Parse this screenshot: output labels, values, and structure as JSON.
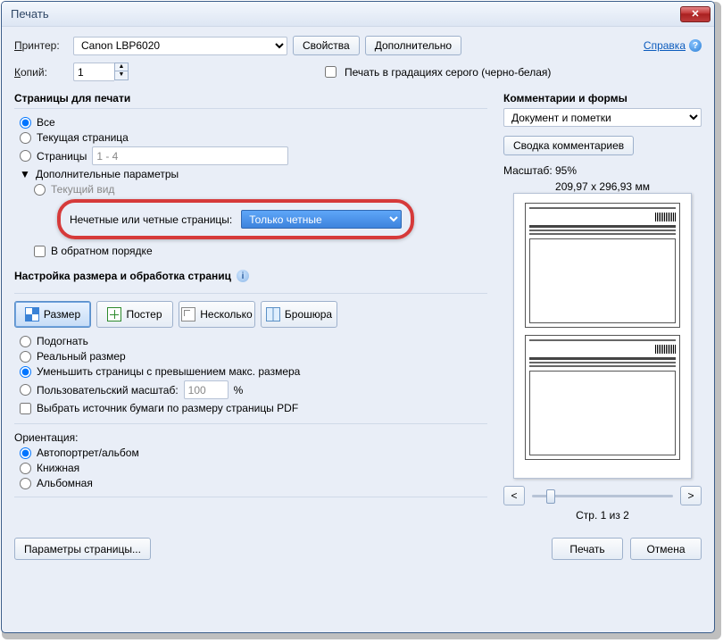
{
  "window": {
    "title": "Печать"
  },
  "top": {
    "printer_label": "Принтер:",
    "printer_value": "Canon LBP6020",
    "properties_btn": "Свойства",
    "advanced_btn": "Дополнительно",
    "help_link": "Справка",
    "copies_label": "Копий:",
    "copies_value": "1",
    "grayscale_label": "Печать в градациях серого (черно-белая)"
  },
  "pages": {
    "title": "Страницы для печати",
    "all": "Все",
    "current": "Текущая страница",
    "pages_label": "Страницы",
    "pages_value": "1 - 4",
    "more_opts": "Дополнительные параметры",
    "current_view": "Текущий вид",
    "odd_even_label": "Нечетные или четные страницы:",
    "odd_even_value": "Только четные",
    "reverse": "В обратном порядке"
  },
  "sizing": {
    "title": "Настройка размера и обработка страниц",
    "size": "Размер",
    "poster": "Постер",
    "nup": "Несколько",
    "booklet": "Брошюра",
    "fit": "Подогнать",
    "actual": "Реальный размер",
    "shrink": "Уменьшить страницы с превышением макс. размера",
    "custom": "Пользовательский масштаб:",
    "custom_value": "100",
    "percent": "%",
    "paper_source": "Выбрать источник бумаги по размеру страницы PDF"
  },
  "orientation": {
    "title": "Ориентация:",
    "auto": "Автопортрет/альбом",
    "portrait": "Книжная",
    "landscape": "Альбомная"
  },
  "comments": {
    "title": "Комментарии и формы",
    "select_value": "Документ и пометки",
    "summary_btn": "Сводка комментариев"
  },
  "preview": {
    "scale_label": "Масштаб:  95%",
    "dimensions": "209,97 x 296,93 мм",
    "page_of": "Стр. 1 из 2",
    "prev": "<",
    "next": ">"
  },
  "footer": {
    "page_setup": "Параметры страницы...",
    "print": "Печать",
    "cancel": "Отмена"
  }
}
